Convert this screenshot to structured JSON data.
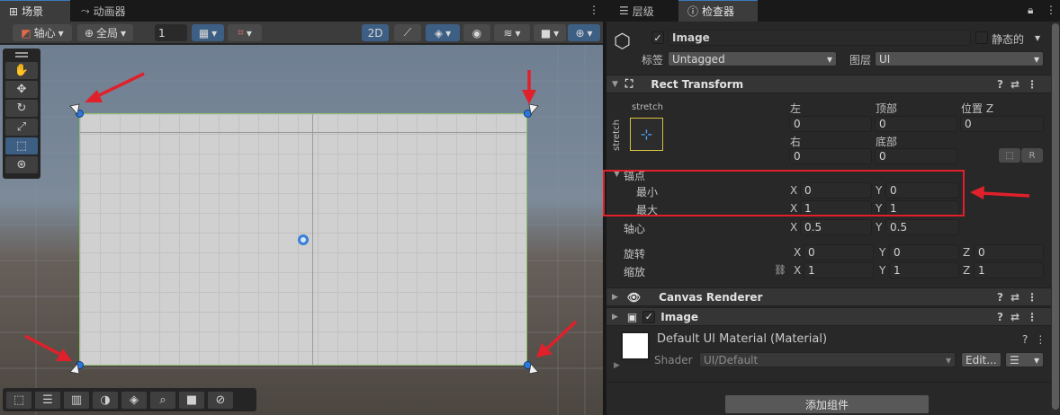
{
  "scene": {
    "tabs": [
      {
        "icon": "grid-icon",
        "label": "场景"
      },
      {
        "icon": "animation-icon",
        "label": "动画器"
      }
    ],
    "toolbar": {
      "pivot": "轴心",
      "global": "全局",
      "grid_value": "1",
      "mode_2d": "2D"
    }
  },
  "inspector": {
    "tabs": [
      {
        "icon": "list-icon",
        "label": "层级"
      },
      {
        "icon": "info-icon",
        "label": "检查器"
      }
    ],
    "object": {
      "name": "Image",
      "active": true,
      "static_label": "静态的",
      "tag_label": "标签",
      "tag_value": "Untagged",
      "layer_label": "图层",
      "layer_value": "UI"
    },
    "rect_transform": {
      "title": "Rect Transform",
      "preset_top": "stretch",
      "preset_side": "stretch",
      "labels": {
        "left": "左",
        "top": "顶部",
        "pos_z": "位置 Z",
        "right": "右",
        "bottom": "底部"
      },
      "values": {
        "left": "0",
        "top": "0",
        "pos_z": "0",
        "right": "0",
        "bottom": "0"
      },
      "r_button": "R",
      "anchors": {
        "title": "锚点",
        "min_label": "最小",
        "max_label": "最大",
        "min_x": "0",
        "min_y": "0",
        "max_x": "1",
        "max_y": "1"
      },
      "pivot": {
        "label": "轴心",
        "x": "0.5",
        "y": "0.5"
      },
      "rotation": {
        "label": "旋转",
        "x": "0",
        "y": "0",
        "z": "0"
      },
      "scale": {
        "label": "缩放",
        "x": "1",
        "y": "1",
        "z": "1"
      },
      "axis": {
        "x": "X",
        "y": "Y",
        "z": "Z"
      }
    },
    "canvas_renderer": {
      "title": "Canvas Renderer"
    },
    "image": {
      "title": "Image",
      "material": "Default UI Material (Material)",
      "shader_label": "Shader",
      "shader_value": "UI/Default",
      "edit": "Edit..."
    },
    "add_component": "添加组件"
  },
  "colors": {
    "accent": "#3a79bb",
    "highlight": "#e0202a",
    "handle": "#2d77d8"
  }
}
